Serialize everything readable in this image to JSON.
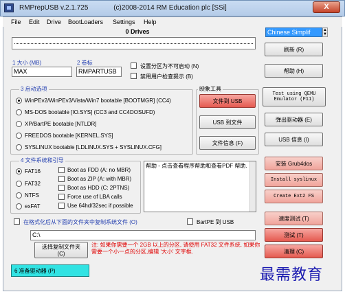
{
  "window": {
    "title": "RMPrepUSB v.2.1.725",
    "copyright": "(c)2008-2014 RM Education plc [SSi]",
    "close_label": "X"
  },
  "menu": [
    "File",
    "Edit",
    "Drive",
    "BootLoaders",
    "Settings",
    "Help"
  ],
  "drives": {
    "label": "0 Drives"
  },
  "language": {
    "selected": "Chinese Simplif"
  },
  "buttons": {
    "refresh": "刷新 (R)",
    "help": "帮助 (H)",
    "to_usb": "文件到 USB",
    "usb_to_file": "USB 到文件",
    "file_info": "文件信息 (F)",
    "test_qemu_line1": "Test using QEMU",
    "test_qemu_line2": "Emulator (F11)",
    "eject": "弹出驱动器 (E)",
    "usb_info": "USB 信息 (I)",
    "install_grub4dos": "安装 Grub4dos",
    "install_syslinux": "Install syslinux",
    "create_ext2": "Create Ext2 FS",
    "speed_test": "速度测试 (T)",
    "test": "测试 (T)",
    "clean": "清理 (C)",
    "choose_folder_line1": "选择复制文件夹",
    "choose_folder_line2": "(C)",
    "prepare": "6 准备驱动器 (P)"
  },
  "size": {
    "label": "1 大小 (MB)",
    "value": "MAX"
  },
  "volume": {
    "label": "2 卷标",
    "value": "RMPARTUSB"
  },
  "options": {
    "no_boot": "设置分区为不可启动 (N)",
    "no_prompt": "禁用用户检查提示 (B)"
  },
  "tools_group": {
    "title": "映象工具"
  },
  "boot_options": {
    "title": "3 启动选项",
    "items": [
      {
        "label": "WinPEv2/WinPEv3/Vista/Win7 bootable [BOOTMGR] (CC4)",
        "selected": true
      },
      {
        "label": "MS-DOS bootable [IO.SYS]    (CC3 and CC4DOSUFD)",
        "selected": false
      },
      {
        "label": "XP/BartPE bootable [NTLDR]",
        "selected": false
      },
      {
        "label": "FREEDOS bootable [KERNEL.SYS]",
        "selected": false
      },
      {
        "label": "SYSLINUX bootable [LDLINUX.SYS + SYSLINUX.CFG]",
        "selected": false
      }
    ]
  },
  "filesystem": {
    "title": "4 文件系统和引导",
    "fs": [
      {
        "label": "FAT16",
        "selected": true
      },
      {
        "label": "FAT32",
        "selected": false
      },
      {
        "label": "NTFS",
        "selected": false
      },
      {
        "label": "exFAT",
        "selected": false
      }
    ],
    "checks": [
      "Boot as FDD (A: no MBR)",
      "Boot as ZIP (A: with MBR)",
      "Boot as HDD (C: 2PTNS)",
      "Force use of LBA calls",
      "Use 64hd/32sec if possible"
    ]
  },
  "help_text": "帮助 - 点击查看程序帮助和查看PDF 帮助.",
  "copy_files": {
    "label": "在格式化后从下面的文件夹中复制系统文件 (O)",
    "bartpe": "BartPE 到 USB",
    "path": "C:\\"
  },
  "note": "注: 如果你需要一个 2GB 以上的分区, 请使用 FAT32 文件系统. 如果你需要一个小一点的分区,编辑 '大小' 文字框.",
  "watermark": "最需教育"
}
